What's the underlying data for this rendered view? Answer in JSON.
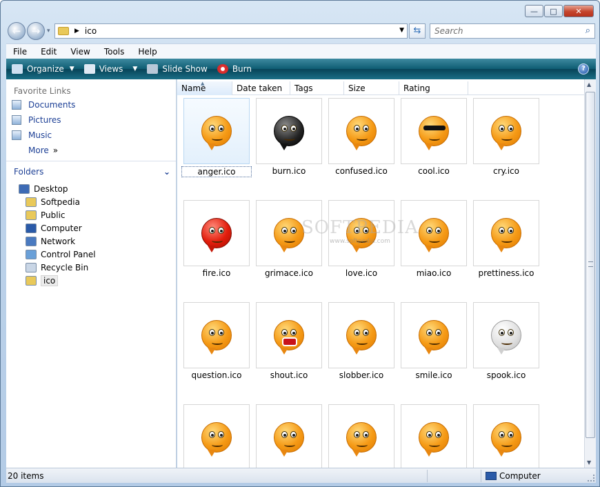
{
  "window": {
    "minimize": "—",
    "maximize": "□",
    "close": "✕"
  },
  "nav": {
    "back": "←",
    "forward": "→",
    "recent": "▾"
  },
  "address": {
    "path": "ico",
    "refresh": "⇆"
  },
  "search": {
    "placeholder": "Search",
    "icon": "⌕"
  },
  "menu": [
    "File",
    "Edit",
    "View",
    "Tools",
    "Help"
  ],
  "toolbar": {
    "organize": "Organize",
    "views": "Views",
    "slideshow": "Slide Show",
    "burn": "Burn",
    "help": "?"
  },
  "sidebar": {
    "favorites_heading": "Favorite Links",
    "favorites": [
      "Documents",
      "Pictures",
      "Music"
    ],
    "more": "More",
    "more_chevron": "»",
    "folders_heading": "Folders",
    "folders_chevron": "⌄",
    "tree": [
      {
        "label": "Desktop",
        "icon": "desktop-icon",
        "color": "#3d6bb5"
      },
      {
        "label": "Softpedia",
        "icon": "folder-icon",
        "color": "#e9c95a"
      },
      {
        "label": "Public",
        "icon": "folder-icon",
        "color": "#e9c95a"
      },
      {
        "label": "Computer",
        "icon": "computer-icon",
        "color": "#2a5aa8"
      },
      {
        "label": "Network",
        "icon": "network-icon",
        "color": "#4a7ac0"
      },
      {
        "label": "Control Panel",
        "icon": "control-panel-icon",
        "color": "#6aa0d8"
      },
      {
        "label": "Recycle Bin",
        "icon": "recycle-bin-icon",
        "color": "#c9d6e6"
      },
      {
        "label": "ico",
        "icon": "folder-icon",
        "color": "#e9c95a"
      }
    ]
  },
  "columns": [
    "Name",
    "Date taken",
    "Tags",
    "Size",
    "Rating"
  ],
  "sort_arrow": "▲",
  "files": [
    {
      "name": "anger.ico",
      "style": "orange",
      "selected": true
    },
    {
      "name": "burn.ico",
      "style": "black"
    },
    {
      "name": "confused.ico",
      "style": "orange"
    },
    {
      "name": "cool.ico",
      "style": "glasses"
    },
    {
      "name": "cry.ico",
      "style": "orange"
    },
    {
      "name": "fire.ico",
      "style": "red"
    },
    {
      "name": "grimace.ico",
      "style": "orange"
    },
    {
      "name": "love.ico",
      "style": "orange"
    },
    {
      "name": "miao.ico",
      "style": "orange"
    },
    {
      "name": "prettiness.ico",
      "style": "orange"
    },
    {
      "name": "question.ico",
      "style": "orange"
    },
    {
      "name": "shout.ico",
      "style": "shout"
    },
    {
      "name": "slobber.ico",
      "style": "orange"
    },
    {
      "name": "smile.ico",
      "style": "orange"
    },
    {
      "name": "spook.ico",
      "style": "white"
    },
    {
      "name": "",
      "style": "orange"
    },
    {
      "name": "",
      "style": "orange"
    },
    {
      "name": "",
      "style": "orange"
    },
    {
      "name": "",
      "style": "orange"
    },
    {
      "name": "",
      "style": "orange"
    }
  ],
  "watermark": {
    "text": "SOFTPEDIA",
    "sub": "www.softpedia.com"
  },
  "status": {
    "items": "20 items",
    "location": "Computer"
  },
  "scrollbar": {
    "up": "▲",
    "down": "▼"
  }
}
